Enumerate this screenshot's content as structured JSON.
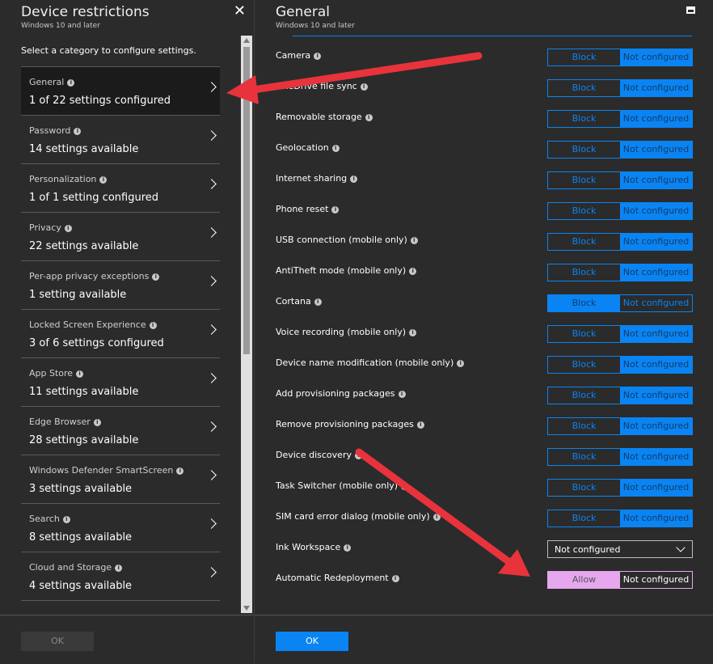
{
  "left": {
    "title": "Device restrictions",
    "subtitle": "Windows 10 and later",
    "lead": "Select a category to configure settings.",
    "categories": [
      {
        "name": "General",
        "status": "1 of 22 settings configured"
      },
      {
        "name": "Password",
        "status": "14 settings available"
      },
      {
        "name": "Personalization",
        "status": "1 of 1 setting configured"
      },
      {
        "name": "Privacy",
        "status": "22 settings available"
      },
      {
        "name": "Per-app privacy exceptions",
        "status": "1 setting available"
      },
      {
        "name": "Locked Screen Experience",
        "status": "3 of 6 settings configured"
      },
      {
        "name": "App Store",
        "status": "11 settings available"
      },
      {
        "name": "Edge Browser",
        "status": "28 settings available"
      },
      {
        "name": "Windows Defender SmartScreen",
        "status": "3 settings available"
      },
      {
        "name": "Search",
        "status": "8 settings available"
      },
      {
        "name": "Cloud and Storage",
        "status": "4 settings available"
      }
    ],
    "ok": "OK"
  },
  "right": {
    "title": "General",
    "subtitle": "Windows 10 and later",
    "block_label": "Block",
    "notconf_label": "Not configured",
    "allow_label": "Allow",
    "settings": [
      {
        "label": "Camera"
      },
      {
        "label": "OneDrive file sync"
      },
      {
        "label": "Removable storage"
      },
      {
        "label": "Geolocation"
      },
      {
        "label": "Internet sharing"
      },
      {
        "label": "Phone reset"
      },
      {
        "label": "USB connection (mobile only)"
      },
      {
        "label": "AntiTheft mode (mobile only)"
      },
      {
        "label": "Cortana"
      },
      {
        "label": "Voice recording (mobile only)"
      },
      {
        "label": "Device name modification (mobile only)"
      },
      {
        "label": "Add provisioning packages"
      },
      {
        "label": "Remove provisioning packages"
      },
      {
        "label": "Device discovery"
      },
      {
        "label": "Task Switcher (mobile only)"
      },
      {
        "label": "SIM card error dialog (mobile only)"
      },
      {
        "label": "Ink Workspace"
      },
      {
        "label": "Automatic Redeployment"
      }
    ],
    "ink_value": "Not configured",
    "ok": "OK"
  },
  "colors": {
    "accent": "#0a84f2",
    "annotation_arrow": "#e8333c"
  }
}
